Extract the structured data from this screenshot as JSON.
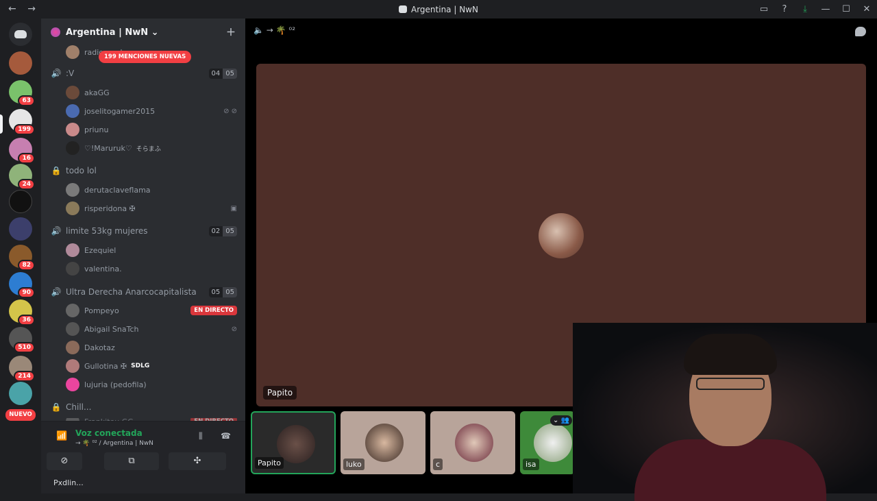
{
  "window": {
    "title": "Argentina | NwN",
    "back": "←",
    "forward": "→"
  },
  "window_controls": {
    "screen": "▭",
    "help": "?",
    "download": "⤓",
    "minimize": "—",
    "maximize": "☐",
    "close": "✕"
  },
  "guilds": {
    "home_icon": "discord-logo",
    "badges": [
      "63",
      "199",
      "16",
      "24",
      "82",
      "90",
      "36",
      "510",
      "214"
    ],
    "nuevo_label": "NUEVO"
  },
  "server": {
    "name": "Argentina | NwN ⌄",
    "mentions_banner": "199 MENCIONES NUEVAS"
  },
  "channel_list": {
    "top_user": "radiogood",
    "channels": [
      {
        "name": ":V",
        "count_a": "04",
        "count_b": "05"
      },
      {
        "name": "todo lol"
      },
      {
        "name": "limite 53kg mujeres",
        "count_a": "02",
        "count_b": "05"
      },
      {
        "name": "Ultra Derecha Anarcocapitalista",
        "count_a": "05",
        "count_b": "05"
      },
      {
        "name": "Chill..."
      }
    ],
    "users_v": [
      "akaGG",
      "joselitogamer2015",
      "priunu",
      "♡!Maruruk♡",
      "そらまふ"
    ],
    "users_lol": [
      "derutaclaveflama",
      "risperidona ✠"
    ],
    "users_limite": [
      "Ezequiel",
      "valentina."
    ],
    "users_ultra": [
      "Pompeyo",
      "Abigail SnaTch",
      "Dakotaz",
      "Gullotina ✠",
      "lujuria (pedofila)"
    ],
    "sdlg_tag": "SDLG",
    "live_label": "EN DIRECTO",
    "chill_partial": "Frankitou GG"
  },
  "voice": {
    "status": "Voz conectada",
    "location": "→ 🌴 ⁰² / Argentina | NwN",
    "btn_share": "⊘",
    "btn_activity": "⧉",
    "btn_soundboard": "✣"
  },
  "user_bar": {
    "name": "Pxdlin..."
  },
  "call": {
    "header": "🔈 → 🌴 ⁰²",
    "focused_name": "Papito",
    "tiles": [
      {
        "name": "Papito"
      },
      {
        "name": "luko"
      },
      {
        "name": "c"
      },
      {
        "name": "isa"
      }
    ]
  }
}
